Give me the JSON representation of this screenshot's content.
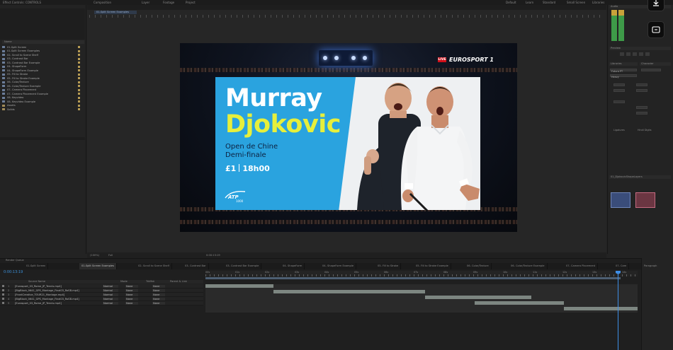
{
  "topbar": {
    "tabs": [
      "Effect Controls: CONTROLS",
      "Composition",
      "Layer",
      "Footage",
      "Project",
      "Default",
      "Learn",
      "Standard",
      "Small Screen",
      "Libraries"
    ]
  },
  "project": {
    "header": "Name",
    "items": [
      {
        "label": "01-Split Screen",
        "type": "comp"
      },
      {
        "label": "01-Split Screen Examples",
        "type": "comp"
      },
      {
        "label": "02- Scroll to Scene Shelf",
        "type": "comp"
      },
      {
        "label": "03- Contrast Bar",
        "type": "comp"
      },
      {
        "label": "03- Contrast Bar Example",
        "type": "comp"
      },
      {
        "label": "04- ShapeForm",
        "type": "comp"
      },
      {
        "label": "04- ShapeForm Example",
        "type": "comp"
      },
      {
        "label": "05- Fill to Stroke",
        "type": "comp"
      },
      {
        "label": "05- Fill to Stroke Example",
        "type": "comp"
      },
      {
        "label": "06- Color/Texture",
        "type": "comp"
      },
      {
        "label": "06- Color/Texture Example",
        "type": "comp"
      },
      {
        "label": "07- Camera Placement",
        "type": "comp"
      },
      {
        "label": "07- Camera Placement Example",
        "type": "comp"
      },
      {
        "label": "08- Keyvideo",
        "type": "comp"
      },
      {
        "label": "08- Keyvideo Example",
        "type": "comp"
      },
      {
        "label": "Assets",
        "type": "folder"
      },
      {
        "label": "Solids",
        "type": "folder"
      }
    ]
  },
  "viewer": {
    "comp_tab": "Composition",
    "comp_subtab": "01-Split Screen Examples",
    "zoom": "(100%)",
    "resolution": "Full",
    "timecode_display": "0:00:13:19"
  },
  "card": {
    "name1": "Murray",
    "name2": "Djokovic",
    "event_line1": "Open de Chine",
    "event_line2": "Demi-finale",
    "channel": "£1",
    "time": "18h00",
    "atp_label": "ATP",
    "atp_sub": "1000",
    "live_badge": "LIVE",
    "broadcaster": "EUROSPORT 1",
    "colors": {
      "blue": "#2aa3df",
      "yellow": "#e6ef3c",
      "navy": "#0d2140"
    }
  },
  "right_panel": {
    "audio_label": "Audio",
    "preview_label": "Preview",
    "libraries_label": "Libraries",
    "character_label": "Character",
    "font": "Futura PT",
    "style": "Heavy",
    "paragraph_label": "Paragraph",
    "essential_label": "01_DjokovicShapeLayers",
    "faux_bold": "Ligatures",
    "hindi_digits": "Hindi Digits"
  },
  "timeline": {
    "render_queue_tab": "Render Queue",
    "tabs": [
      "01-Split Screen",
      "01-Split Screen Examples",
      "02- Scroll to Scene Shelf",
      "03- Contrast Bar",
      "03- Contrast Bar Example",
      "04- ShapeForm",
      "04- ShapeForm Example",
      "05- Fill to Stroke",
      "05- Fill to Stroke Example",
      "06- Color/Texture",
      "06- Color/Texture Example",
      "07- Camera Placement",
      "07- Cam"
    ],
    "active_tab_index": 1,
    "timecode": "0:00:13:19",
    "columns": {
      "name": "Source Name",
      "mode": "Mode",
      "trkmat": "TrkMat",
      "parent": "Parent & Link"
    },
    "layers": [
      {
        "num": "1",
        "name": "[Eurosport_03_Rome_JP_Tennis.mp4]",
        "mode": "Normal",
        "parent": "None",
        "track": "None"
      },
      {
        "num": "2",
        "name": "[BigBlock_0641_GPS_Montage_Final03_RoSB.mp4]",
        "mode": "Normal",
        "parent": "None",
        "track": "None"
      },
      {
        "num": "3",
        "name": "[FrontCreative_TOUR21_Montage.mp4]",
        "mode": "Normal",
        "parent": "None",
        "track": "None"
      },
      {
        "num": "4",
        "name": "[BigBlock_0641_GPS_Montage_Final03_RoSB.mp4]",
        "mode": "Normal",
        "parent": "None",
        "track": "None"
      },
      {
        "num": "5",
        "name": "[Eurosport_03_Rome_JP_Tennis.mp4]",
        "mode": "Normal",
        "parent": "None",
        "track": "None"
      }
    ],
    "ruler_labels": [
      "00s",
      "01s",
      "02s",
      "03s",
      "04s",
      "05s",
      "06s",
      "07s",
      "08s",
      "09s",
      "10s",
      "11s",
      "12s",
      "13s",
      "14s"
    ],
    "paragraph_panel": "Paragraph"
  }
}
